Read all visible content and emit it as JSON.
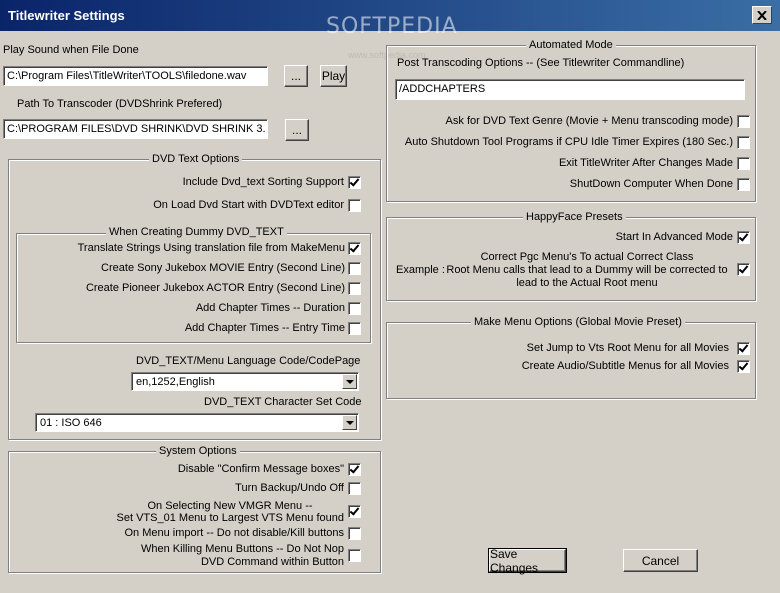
{
  "window": {
    "title": "Titlewriter Settings",
    "watermark": "SOFTPEDIA",
    "watermark_sub": "www.softpedia.com",
    "close_icon": "close-icon"
  },
  "left": {
    "play_sound_label": "Play Sound when File Done",
    "play_sound_value": "C:\\Program Files\\TitleWriter\\TOOLS\\filedone.wav",
    "browse_label": "...",
    "play_label": "Play",
    "transcoder_label": "Path To Transcoder (DVDShrink Prefered)",
    "transcoder_value": "C:\\PROGRAM FILES\\DVD SHRINK\\DVD SHRINK 3.",
    "dvd_text": {
      "title": "DVD Text Options",
      "items": [
        {
          "label": "Include Dvd_text Sorting Support",
          "checked": true
        },
        {
          "label": "On Load Dvd Start with DVDText editor",
          "checked": false
        }
      ],
      "dummy": {
        "title": "When Creating Dummy DVD_TEXT",
        "items": [
          {
            "label": "Translate Strings Using translation file from MakeMenu",
            "checked": true
          },
          {
            "label": "Create Sony Jukebox MOVIE Entry (Second Line)",
            "checked": false
          },
          {
            "label": "Create Pioneer Jukebox ACTOR Entry (Second Line)",
            "checked": false
          },
          {
            "label": "Add Chapter Times -- Duration",
            "checked": false
          },
          {
            "label": "Add Chapter Times -- Entry Time",
            "checked": false
          }
        ]
      },
      "lang_label": "DVD_TEXT/Menu Language Code/CodePage",
      "lang_value": "en,1252,English",
      "charset_label": "DVD_TEXT Character Set  Code",
      "charset_value": "01 : ISO 646"
    },
    "system": {
      "title": "System Options",
      "items": [
        {
          "line1": "Disable \"Confirm Message boxes\"",
          "line2": "",
          "checked": true
        },
        {
          "line1": "Turn Backup/Undo Off",
          "line2": "",
          "checked": false
        },
        {
          "line1": "On Selecting New VMGR Menu --",
          "line2": "Set VTS_01 Menu to Largest VTS Menu  found",
          "checked": true
        },
        {
          "line1": "On Menu import -- Do not disable/Kill buttons",
          "line2": "",
          "checked": false
        },
        {
          "line1": "When Killing Menu Buttons -- Do Not Nop",
          "line2": "DVD Command within Button",
          "checked": false
        }
      ]
    }
  },
  "right": {
    "auto": {
      "title": "Automated Mode",
      "post_label": "Post Transcoding Options -- (See Titlewriter Commandline)",
      "post_value": "/ADDCHAPTERS",
      "items": [
        {
          "label": "Ask for DVD Text Genre (Movie + Menu transcoding mode)",
          "checked": false
        },
        {
          "label": "Auto Shutdown Tool Programs if CPU Idle Timer Expires  (180 Sec.)",
          "checked": false
        },
        {
          "label": "Exit TitleWriter After Changes Made",
          "checked": false
        },
        {
          "label": "ShutDown Computer When Done",
          "checked": false
        }
      ]
    },
    "happy": {
      "title": "HappyFace Presets",
      "start_label": "Start In Advanced Mode",
      "start_checked": true,
      "correct_line1": "Correct Pgc Menu's To actual Correct Class",
      "correct_line2": "Root Menu calls that lead to a Dummy will be corrected to",
      "correct_line3": "lead to the Actual Root menu",
      "example_label": "Example :",
      "correct_checked": true
    },
    "make_menu": {
      "title": "Make Menu Options (Global Movie Preset)",
      "items": [
        {
          "label": "Set  Jump to Vts Root Menu for all Movies",
          "checked": true
        },
        {
          "label": "Create Audio/Subtitle Menus for all Movies",
          "checked": true
        }
      ]
    },
    "save_label": "Save Changes",
    "cancel_label": "Cancel"
  }
}
